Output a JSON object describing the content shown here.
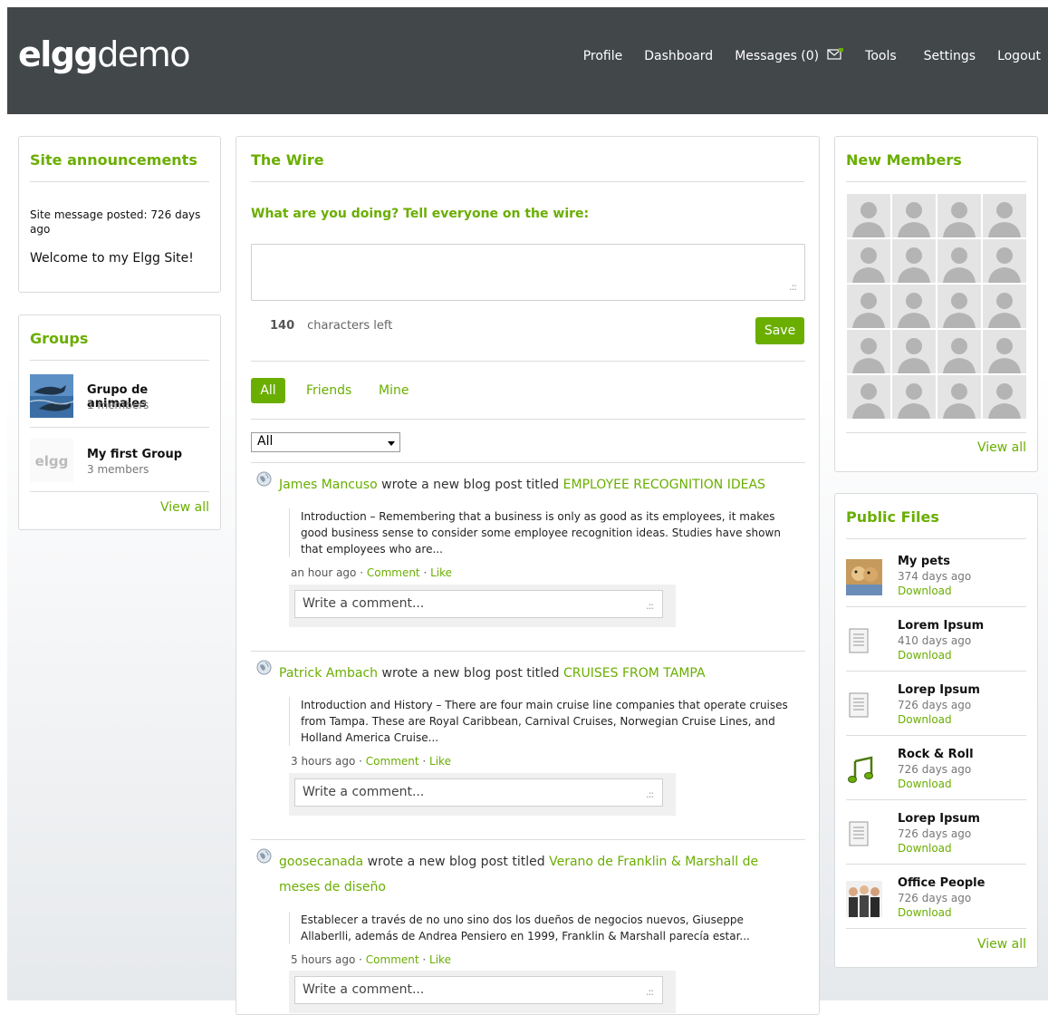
{
  "header": {
    "logo_bold": "elgg",
    "logo_light": "demo",
    "nav": {
      "profile": "Profile",
      "dashboard": "Dashboard",
      "messages": "Messages (0)",
      "tools": "Tools",
      "settings": "Settings",
      "logout": "Logout"
    }
  },
  "announcements": {
    "title": "Site announcements",
    "meta": "Site message posted: 726 days ago",
    "message": "Welcome to my Elgg Site!"
  },
  "groups": {
    "title": "Groups",
    "items": [
      {
        "name": "Grupo de animales",
        "members": "1 members"
      },
      {
        "name": "My first Group",
        "members": "3 members"
      }
    ],
    "view_all": "View all"
  },
  "wire": {
    "title": "The Wire",
    "prompt": "What are you doing? Tell everyone on the wire:",
    "chars_count": "140",
    "chars_label": "characters left",
    "save": "Save",
    "tabs": {
      "all": "All",
      "friends": "Friends",
      "mine": "Mine"
    },
    "filter_value": "All",
    "posts": [
      {
        "user": "James Mancuso",
        "action": " wrote a new blog post titled ",
        "title": "EMPLOYEE RECOGNITION IDEAS",
        "excerpt": "Introduction – Remembering that a business is only as good as its employees, it makes good business sense to consider some employee recognition ideas. Studies have shown that employees who are...",
        "time": "an hour ago",
        "comment": "Comment",
        "like": "Like",
        "comment_placeholder": "Write a comment..."
      },
      {
        "user": "Patrick Ambach",
        "action": " wrote a new blog post titled ",
        "title": "CRUISES FROM TAMPA",
        "excerpt": "Introduction and History – There are four main cruise line companies that operate cruises from Tampa. These are Royal Caribbean, Carnival Cruises, Norwegian Cruise Lines, and Holland America Cruise...",
        "time": "3 hours ago",
        "comment": "Comment",
        "like": "Like",
        "comment_placeholder": "Write a comment..."
      },
      {
        "user": "goosecanada",
        "action": " wrote a new blog post titled ",
        "title": "Verano de Franklin & Marshall de meses de diseño",
        "excerpt": "Establecer a través de no uno sino dos los dueños de negocios nuevos, Giuseppe Allaberlli, además de Andrea Pensiero en 1999, Franklin & Marshall parecía estar...",
        "time": "5 hours ago",
        "comment": "Comment",
        "like": "Like",
        "comment_placeholder": "Write a comment..."
      }
    ],
    "separator": " · "
  },
  "members": {
    "title": "New Members",
    "view_all": "View all"
  },
  "files": {
    "title": "Public Files",
    "items": [
      {
        "name": "My pets",
        "date": "374 days ago",
        "download": "Download",
        "icon": "photo-icon"
      },
      {
        "name": "Lorem Ipsum",
        "date": "410 days ago",
        "download": "Download",
        "icon": "document-icon"
      },
      {
        "name": "Lorep Ipsum",
        "date": "726 days ago",
        "download": "Download",
        "icon": "document-icon"
      },
      {
        "name": "Rock & Roll",
        "date": "726 days ago",
        "download": "Download",
        "icon": "music-icon"
      },
      {
        "name": "Lorep Ipsum",
        "date": "726 days ago",
        "download": "Download",
        "icon": "document-icon"
      },
      {
        "name": "Office People",
        "date": "726 days ago",
        "download": "Download",
        "icon": "photo-icon"
      }
    ],
    "view_all": "View all"
  },
  "colors": {
    "accent": "#6aae00",
    "topbar": "#42474a"
  }
}
